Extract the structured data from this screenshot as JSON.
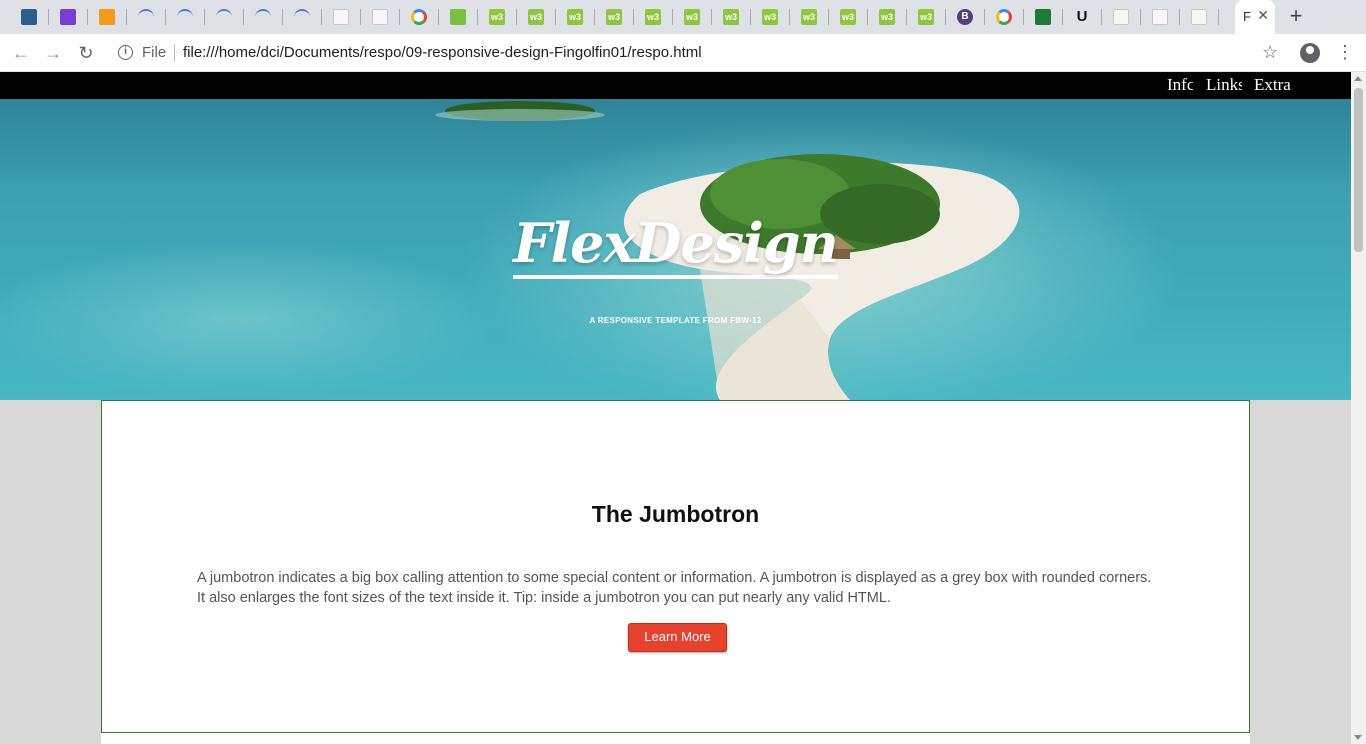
{
  "browser": {
    "tabs": [
      {
        "icon": "github-avatar-icon"
      },
      {
        "icon": "colorful-app-icon"
      },
      {
        "icon": "search-magnifier-icon"
      },
      {
        "icon": "network-icon"
      },
      {
        "icon": "network-icon"
      },
      {
        "icon": "network-icon"
      },
      {
        "icon": "network-icon"
      },
      {
        "icon": "network-icon"
      },
      {
        "icon": "blank-page-icon"
      },
      {
        "icon": "blank-page-icon"
      },
      {
        "icon": "google-icon"
      },
      {
        "icon": "android-icon"
      },
      {
        "icon": "w3schools-icon"
      },
      {
        "icon": "w3schools-icon"
      },
      {
        "icon": "w3schools-icon"
      },
      {
        "icon": "w3schools-icon"
      },
      {
        "icon": "w3schools-icon"
      },
      {
        "icon": "w3schools-icon"
      },
      {
        "icon": "w3schools-icon"
      },
      {
        "icon": "w3schools-icon"
      },
      {
        "icon": "w3schools-icon"
      },
      {
        "icon": "w3schools-icon"
      },
      {
        "icon": "w3schools-icon"
      },
      {
        "icon": "w3schools-icon"
      },
      {
        "icon": "bootstrap-icon"
      },
      {
        "icon": "google-icon"
      },
      {
        "icon": "code-editor-icon"
      },
      {
        "icon": "udemy-icon"
      },
      {
        "icon": "blank-page-icon"
      },
      {
        "icon": "blank-page-icon"
      },
      {
        "icon": "blank-page-icon"
      }
    ],
    "active_tab_title": "F",
    "w3_glyph": "w3",
    "bootstrap_glyph": "B",
    "udemy_glyph": "U",
    "new_tab_glyph": "+",
    "close_glyph": "✕",
    "back_glyph": "←",
    "forward_glyph": "→",
    "reload_glyph": "↻",
    "info_glyph": "i",
    "star_glyph": "☆",
    "menu_glyph": "⋮",
    "security_chip": "File",
    "url": "file:///home/dci/Documents/respo/09-responsive-design-Fingolfin01/respo.html"
  },
  "page": {
    "nav": [
      {
        "label": "Info",
        "visible": "Infc"
      },
      {
        "label": "Links",
        "visible": "Links"
      },
      {
        "label": "Extra",
        "visible": "Extra"
      }
    ],
    "hero": {
      "title": "FlexDesign",
      "subtitle": "A RESPONSIVE TEMPLATE FROM FBW-12"
    },
    "jumbotron": {
      "heading": "The Jumbotron",
      "text": "A jumbotron indicates a big box calling attention to some special content or information. A jumbotron is displayed as a grey box with rounded corners. It also enlarges the font sizes of the text inside it. Tip: inside a jumbotron you can put nearly any valid HTML.",
      "button": "Learn More"
    }
  },
  "colors": {
    "nav_bg": "#000000",
    "button_bg": "#e8422e",
    "page_bg": "#d8d8d8",
    "jumbo_border": "#3a7a2f"
  }
}
